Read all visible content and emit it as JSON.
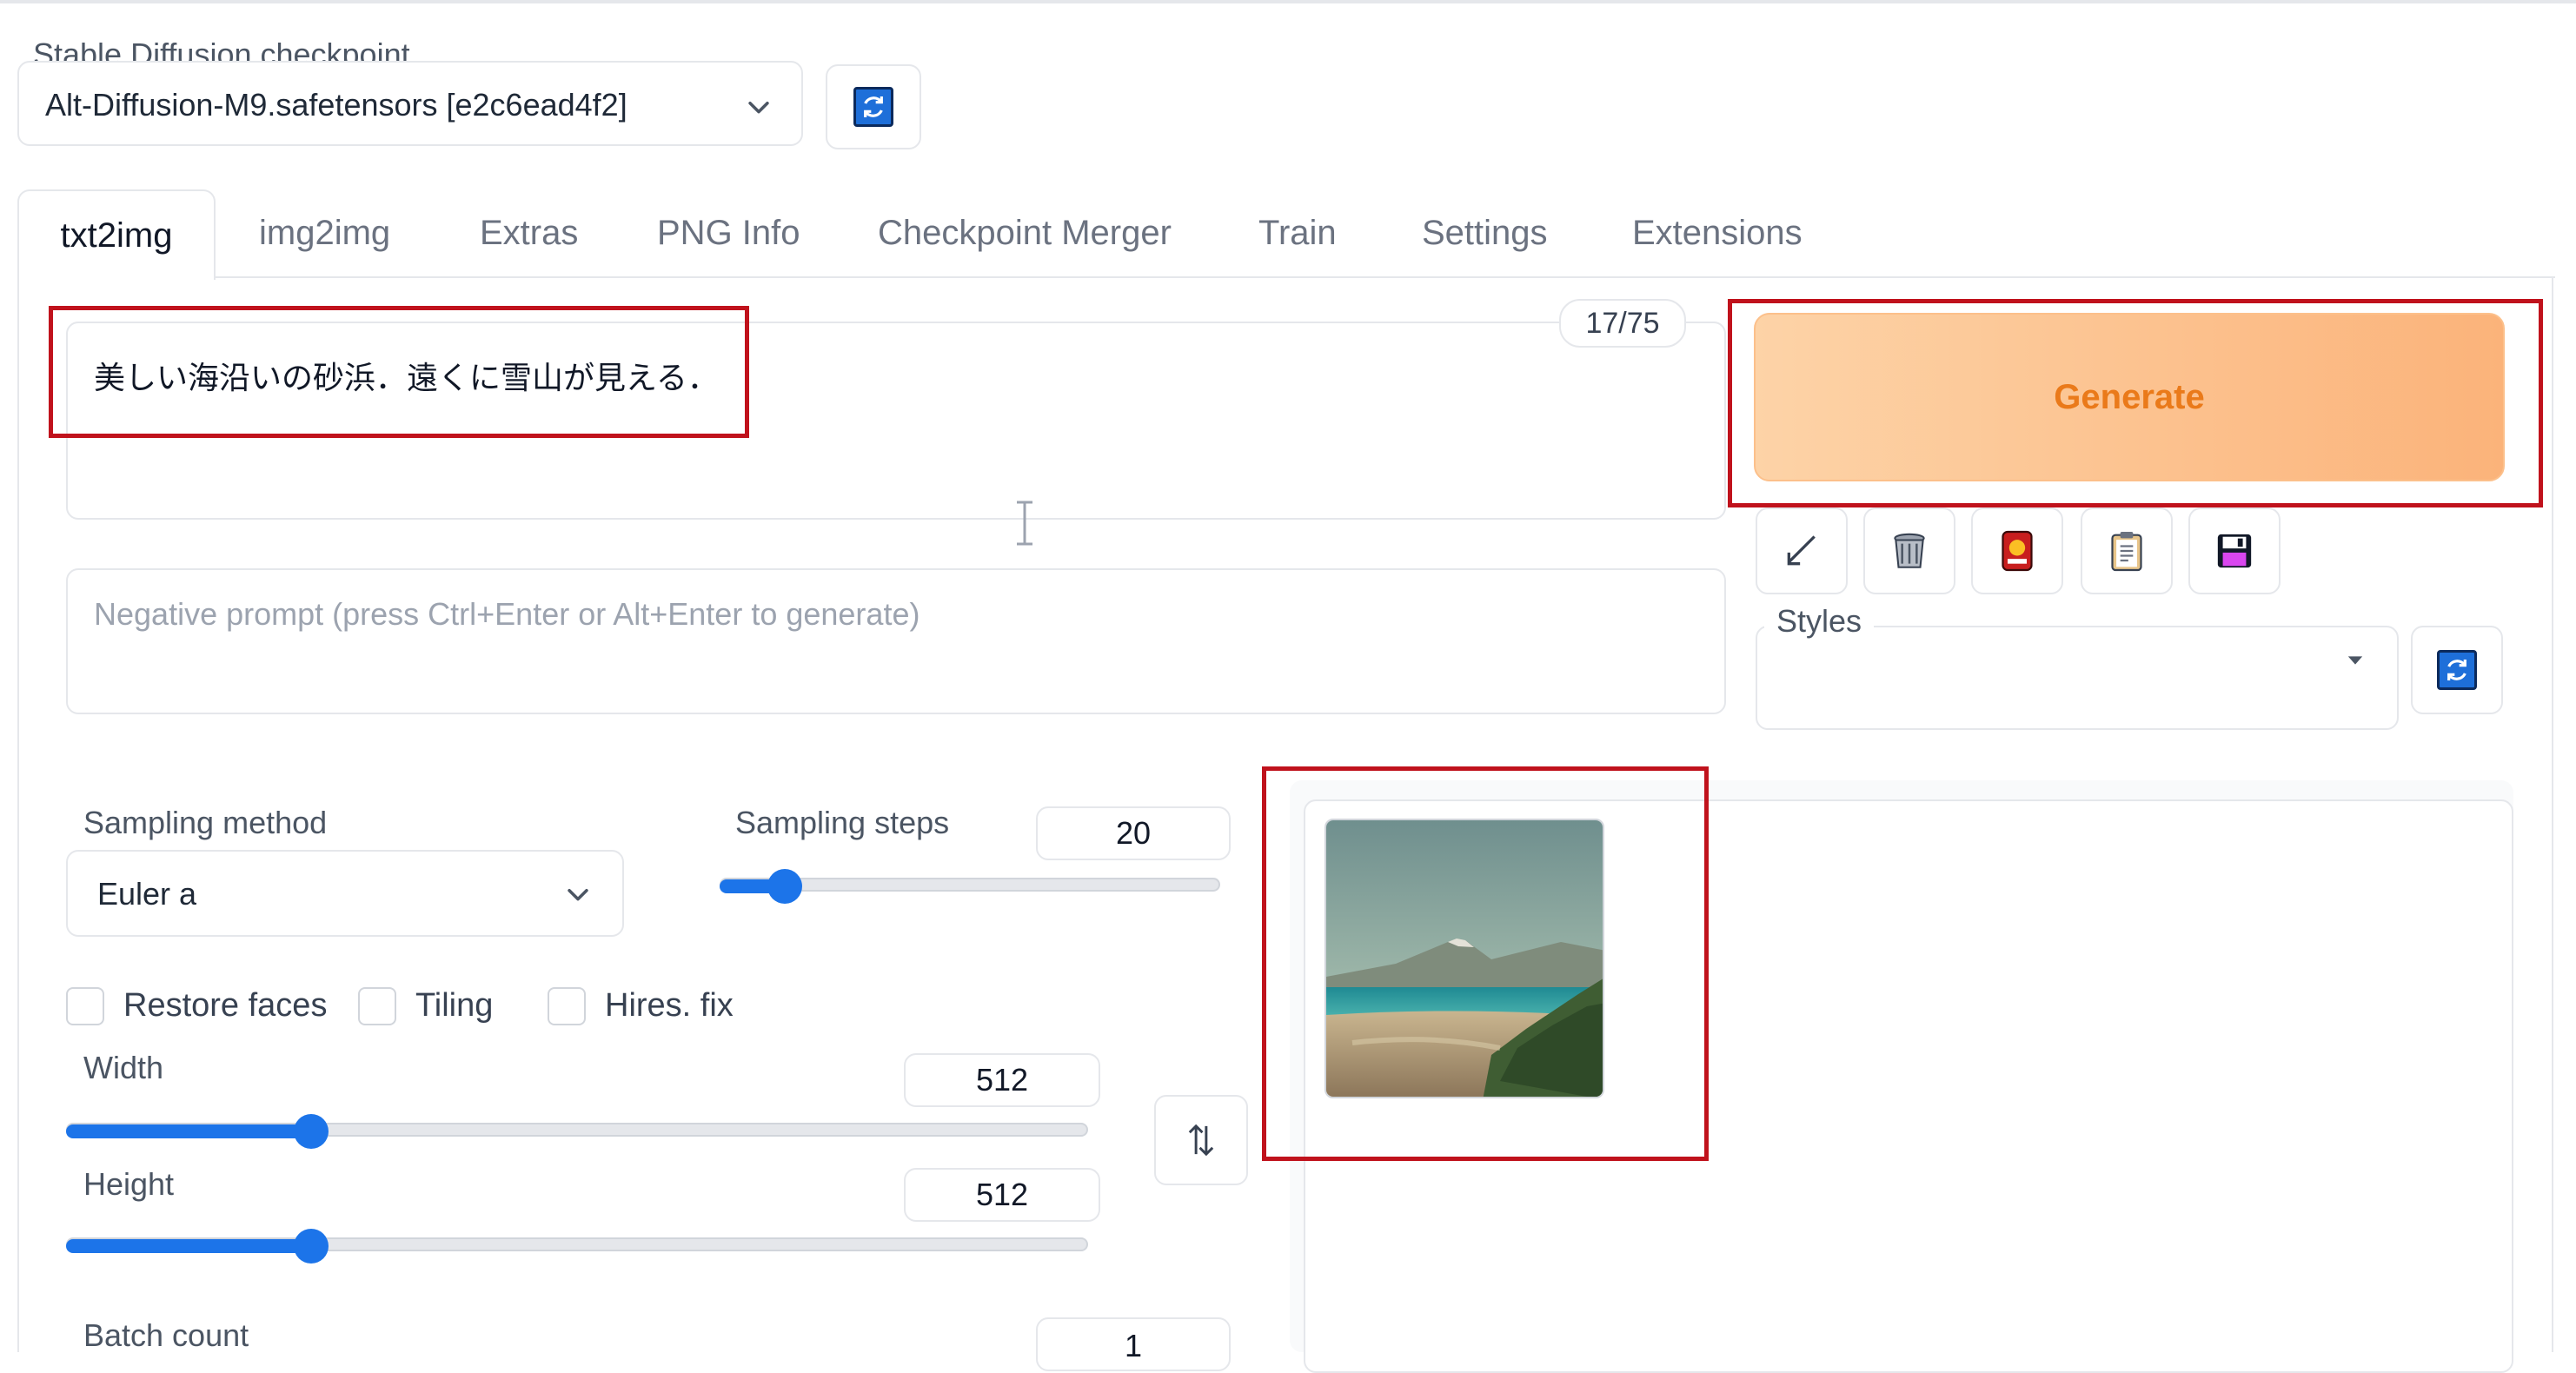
{
  "checkpoint": {
    "label": "Stable Diffusion checkpoint",
    "selected": "Alt-Diffusion-M9.safetensors [e2c6ead4f2]"
  },
  "tabs": [
    {
      "label": "txt2img",
      "active": true
    },
    {
      "label": "img2img"
    },
    {
      "label": "Extras"
    },
    {
      "label": "PNG Info"
    },
    {
      "label": "Checkpoint Merger"
    },
    {
      "label": "Train"
    },
    {
      "label": "Settings"
    },
    {
      "label": "Extensions"
    }
  ],
  "prompt": {
    "value": "美しい海沿いの砂浜．遠くに雪山が見える．",
    "token_counter": "17/75"
  },
  "negative_prompt": {
    "placeholder": "Negative prompt (press Ctrl+Enter or Alt+Enter to generate)"
  },
  "generate": {
    "label": "Generate"
  },
  "tool_icons": [
    "arrow-icon",
    "trash-icon",
    "red-card-icon",
    "clipboard-icon",
    "save-icon"
  ],
  "styles": {
    "label": "Styles",
    "selected": ""
  },
  "sampling": {
    "method_label": "Sampling method",
    "method_value": "Euler a",
    "steps_label": "Sampling steps",
    "steps_value": "20",
    "steps_fraction": 0.13
  },
  "options": {
    "restore_faces": "Restore faces",
    "tiling": "Tiling",
    "hires_fix": "Hires. fix"
  },
  "width": {
    "label": "Width",
    "value": "512",
    "fraction": 0.24
  },
  "height": {
    "label": "Height",
    "value": "512",
    "fraction": 0.24
  },
  "batch_count": {
    "label": "Batch count",
    "value": "1"
  },
  "colors": {
    "accent": "#1c74e9",
    "generate_text": "#ea7a1a",
    "highlight": "#c0121c"
  }
}
